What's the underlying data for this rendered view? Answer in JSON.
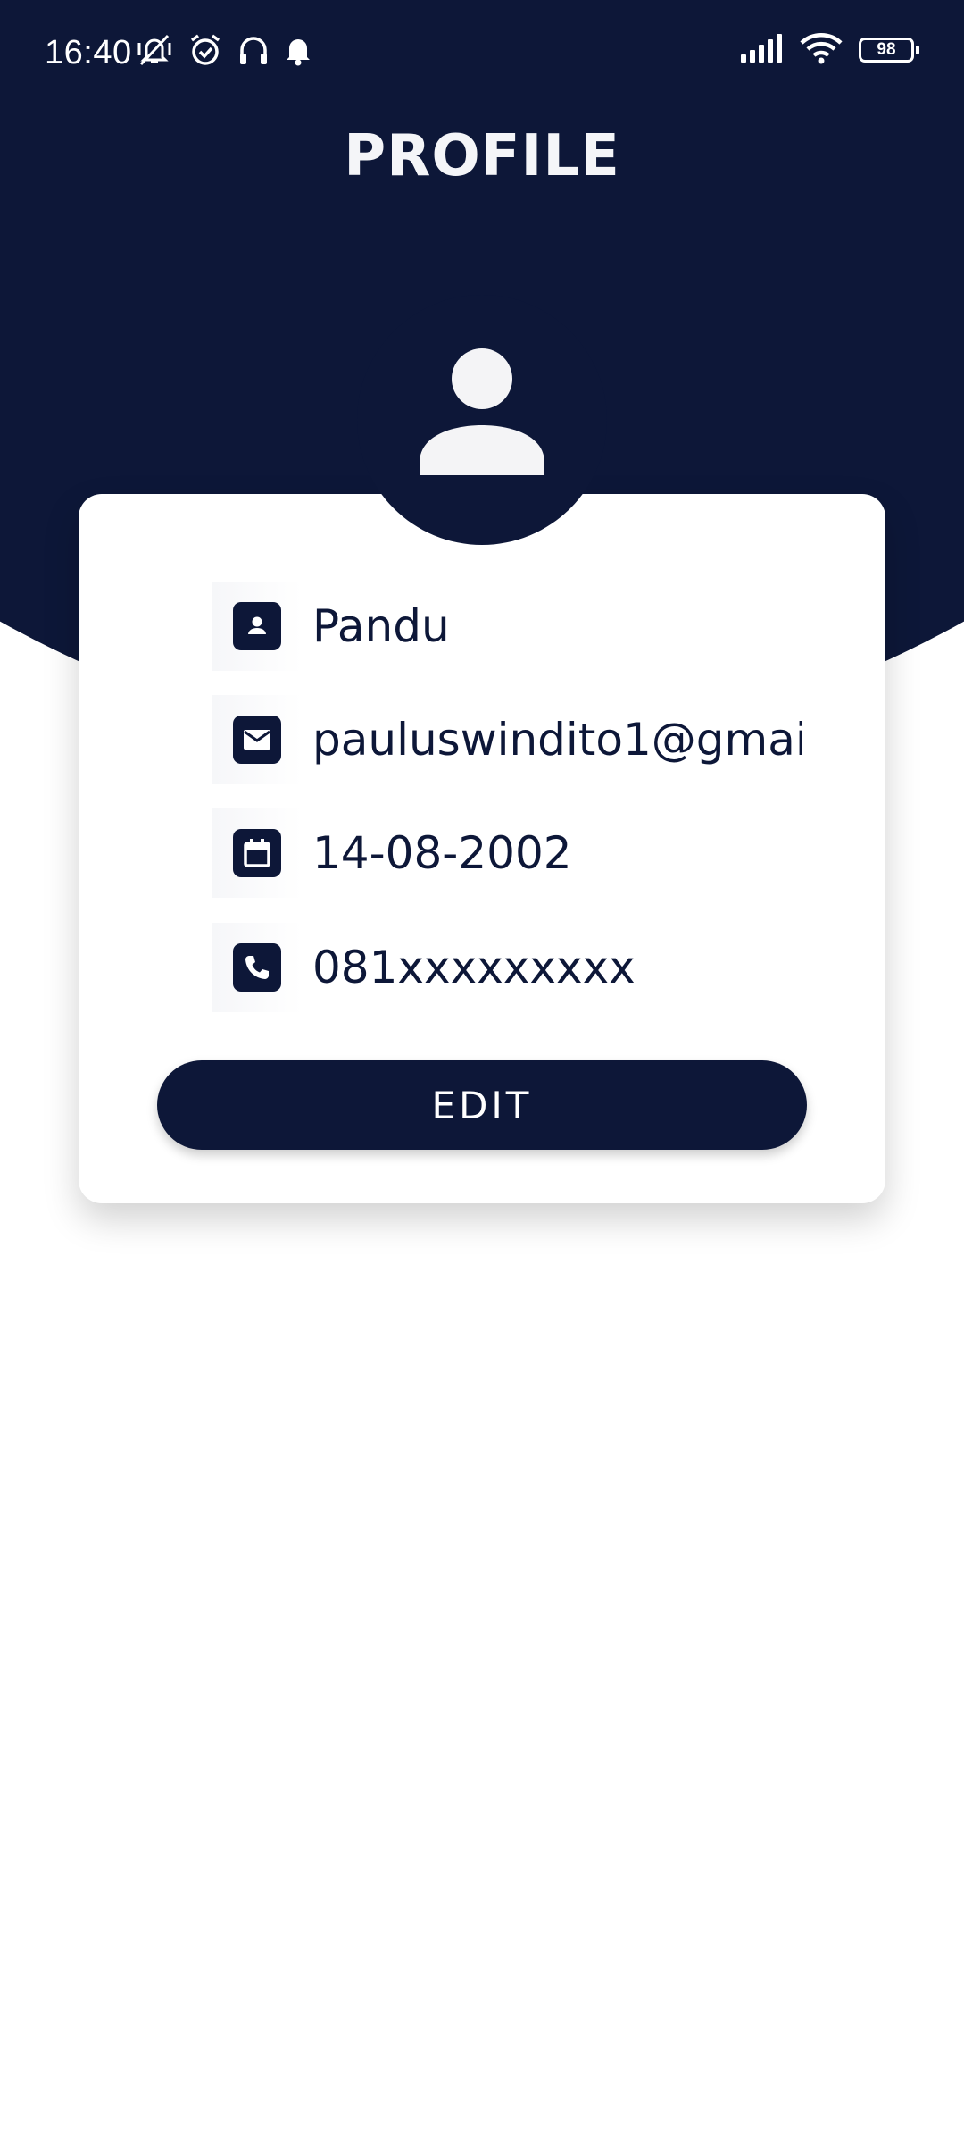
{
  "status_bar": {
    "time": "16:40",
    "battery_level": "98",
    "icons_left": [
      "mute-vibrate-icon",
      "alarm-icon",
      "headphones-icon",
      "notification-bell-icon"
    ],
    "icons_right": [
      "signal-icon",
      "wifi-icon",
      "battery-icon"
    ]
  },
  "header": {
    "title": "PROFILE"
  },
  "profile": {
    "avatar_icon": "person-icon",
    "fields": [
      {
        "icon": "person-badge-icon",
        "value": "Pandu"
      },
      {
        "icon": "email-icon",
        "value": "pauluswindito1@gmai"
      },
      {
        "icon": "calendar-icon",
        "value": "14-08-2002"
      },
      {
        "icon": "phone-icon",
        "value": "081xxxxxxxxx"
      }
    ],
    "edit_label": "EDIT"
  },
  "colors": {
    "primary": "#0d1738",
    "background": "#ffffff",
    "title_text": "#f4f5f8"
  }
}
